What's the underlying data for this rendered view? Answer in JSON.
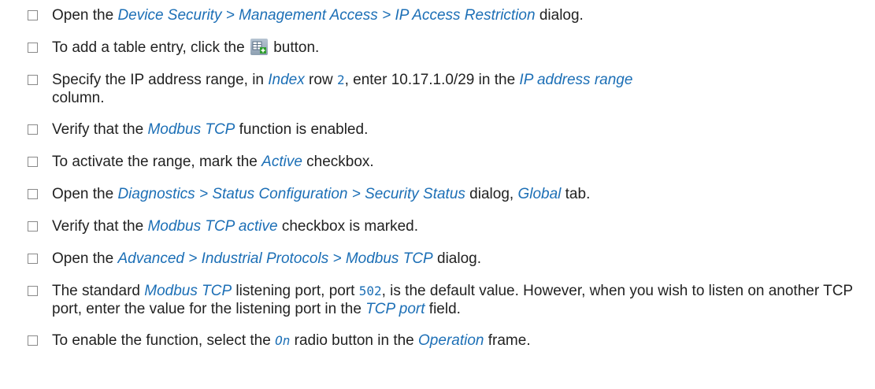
{
  "steps": [
    {
      "pre": "Open the ",
      "ui1": "Device Security > Management Access > IP Access Restriction",
      "post": " dialog."
    },
    {
      "pre": "To add a table entry, click the ",
      "icon": "add-table-entry-icon",
      "post": " button."
    },
    {
      "pre": "Specify the IP address range, in ",
      "ui1": "Index",
      "mid1": " row ",
      "code1": "2",
      "mid2": ", enter 10.17.1.0/29 in the ",
      "ui2": "IP address range",
      "mid3": "",
      "post": "column."
    },
    {
      "pre": "Verify that the ",
      "ui1": "Modbus TCP",
      "post": " function is enabled."
    },
    {
      "pre": "To activate the range, mark the ",
      "ui1": "Active",
      "post": " checkbox."
    },
    {
      "pre": "Open the ",
      "ui1": "Diagnostics > Status Configuration > Security Status",
      "mid1": " dialog, ",
      "ui2": "Global",
      "post": " tab."
    },
    {
      "pre": "Verify that the ",
      "ui1": "Modbus TCP active",
      "post": " checkbox is marked."
    },
    {
      "pre": "Open the ",
      "ui1": "Advanced > Industrial Protocols > Modbus TCP",
      "post": " dialog."
    },
    {
      "pre": "The standard ",
      "ui1": "Modbus TCP",
      "mid1": " listening port, port ",
      "code1": "502",
      "mid2": ", is the default value. However, when you wish to listen on another TCP port, enter the value for the listening port in the ",
      "ui2": "TCP port",
      "post": " field."
    },
    {
      "pre": "To enable the function, select the ",
      "code1": "On",
      "mid1": " radio button in the ",
      "ui1": "Operation",
      "post": " frame."
    }
  ]
}
